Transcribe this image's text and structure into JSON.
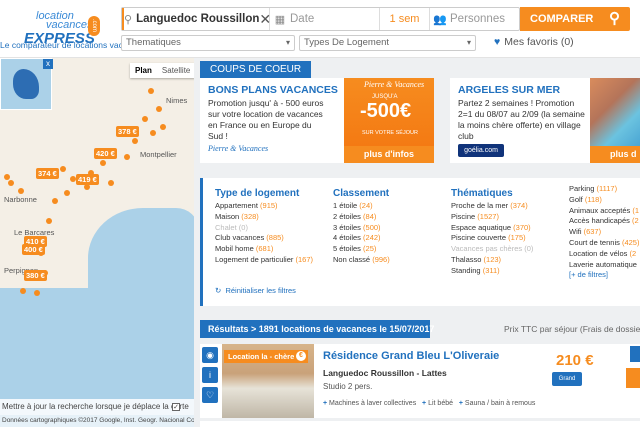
{
  "logo": {
    "line1": "location",
    "line2": "vacances",
    "line3": "EXPRESS",
    "com": ".com",
    "tagline": "Le comparateur de locations vacances"
  },
  "search": {
    "destination": "Languedoc Roussillon",
    "date_placeholder": "Date",
    "duration": "1 sem",
    "persons_placeholder": "Personnes",
    "compare_label": "COMPARER",
    "thematiques": "Thematiques",
    "types": "Types De Logement",
    "favorites": "Mes favoris (0)"
  },
  "map": {
    "type_plan": "Plan",
    "type_satellite": "Satellite",
    "places": [
      "Nimes",
      "Montpellier",
      "Narbonne",
      "Perpignan",
      "Le Barcares"
    ],
    "pins": [
      "378 €",
      "420 €",
      "374 €",
      "419 €",
      "410 €",
      "400 €",
      "380 €"
    ],
    "move_text": "Mettre à jour la recherche lorsque je déplace la carte",
    "footer": "Données cartographiques ©2017 Google, Inst. Geogr. Nacional   Conditions d'utilisation"
  },
  "coups_de_coeur": {
    "label": "COUPS DE COEUR",
    "promo1": {
      "title": "BONS PLANS VACANCES",
      "text": "Promotion jusqu' à - 500 euros sur votre location de vacances en France ou en Europe du Sud !",
      "brand": "Pierre & Vacances",
      "img_brand": "Pierre & Vacances",
      "img_jusqua": "JUSQU'A",
      "img_big": "-500€",
      "img_sur": "SUR VOTRE SÉJOUR",
      "button": "plus d'infos"
    },
    "promo2": {
      "title": "ARGELES SUR MER",
      "text": "Partez 2 semaines ! Promotion 2=1 du 08/07 au 2/09 (la semaine la moins chère offerte) en village club",
      "brand": "goélia.com",
      "button": "plus d"
    }
  },
  "filters": {
    "type_logement": {
      "title": "Type de logement",
      "items": [
        {
          "label": "Appartement",
          "count": "(915)"
        },
        {
          "label": "Maison",
          "count": "(328)"
        },
        {
          "label": "Chalet",
          "count": "(0)"
        },
        {
          "label": "Club vacances",
          "count": "(885)"
        },
        {
          "label": "Mobil home",
          "count": "(681)"
        },
        {
          "label": "Logement de particulier",
          "count": "(167)"
        }
      ]
    },
    "classement": {
      "title": "Classement",
      "items": [
        {
          "label": "1 étoile",
          "count": "(24)"
        },
        {
          "label": "2 étoiles",
          "count": "(84)"
        },
        {
          "label": "3 étoiles",
          "count": "(500)"
        },
        {
          "label": "4 étoiles",
          "count": "(242)"
        },
        {
          "label": "5 étoiles",
          "count": "(25)"
        },
        {
          "label": "Non classé",
          "count": "(996)"
        }
      ]
    },
    "thematiques": {
      "title": "Thématiques",
      "items": [
        {
          "label": "Proche de la mer",
          "count": "(374)"
        },
        {
          "label": "Piscine",
          "count": "(1527)"
        },
        {
          "label": "Espace aquatique",
          "count": "(370)"
        },
        {
          "label": "Piscine couverte",
          "count": "(175)"
        },
        {
          "label": "Vacances pas chères",
          "count": "(0)"
        },
        {
          "label": "Thalasso",
          "count": "(123)"
        },
        {
          "label": "Standing",
          "count": "(311)"
        }
      ]
    },
    "services": {
      "items": [
        {
          "label": "Parking",
          "count": "(1117)"
        },
        {
          "label": "Golf",
          "count": "(118)"
        },
        {
          "label": "Animaux acceptés",
          "count": "(1"
        },
        {
          "label": "Accès handicapés",
          "count": "(2"
        },
        {
          "label": "Wifi",
          "count": "(637)"
        },
        {
          "label": "Court de tennis",
          "count": "(425)"
        },
        {
          "label": "Location de vélos",
          "count": "(2"
        },
        {
          "label": "Laverie automatique",
          "count": ""
        }
      ],
      "more": "[+ de filtres]"
    },
    "reset": "Réinitialiser les filtres"
  },
  "results": {
    "bar": "Résultats > 1891 locations de vacances le 15/07/2017",
    "price_note": "Prix TTC par séjour (Frais de dossier",
    "card": {
      "badge": "Location la - chère",
      "title": "Résidence Grand Bleu L'Oliveraie",
      "location": "Languedoc Roussillon - Lattes",
      "persons": "Studio 2 pers.",
      "amenities": [
        "Machines à laver collectives",
        "Lit bébé",
        "Sauna / bain à remous"
      ],
      "price": "210 €",
      "partner": "Grand Bleu"
    }
  }
}
